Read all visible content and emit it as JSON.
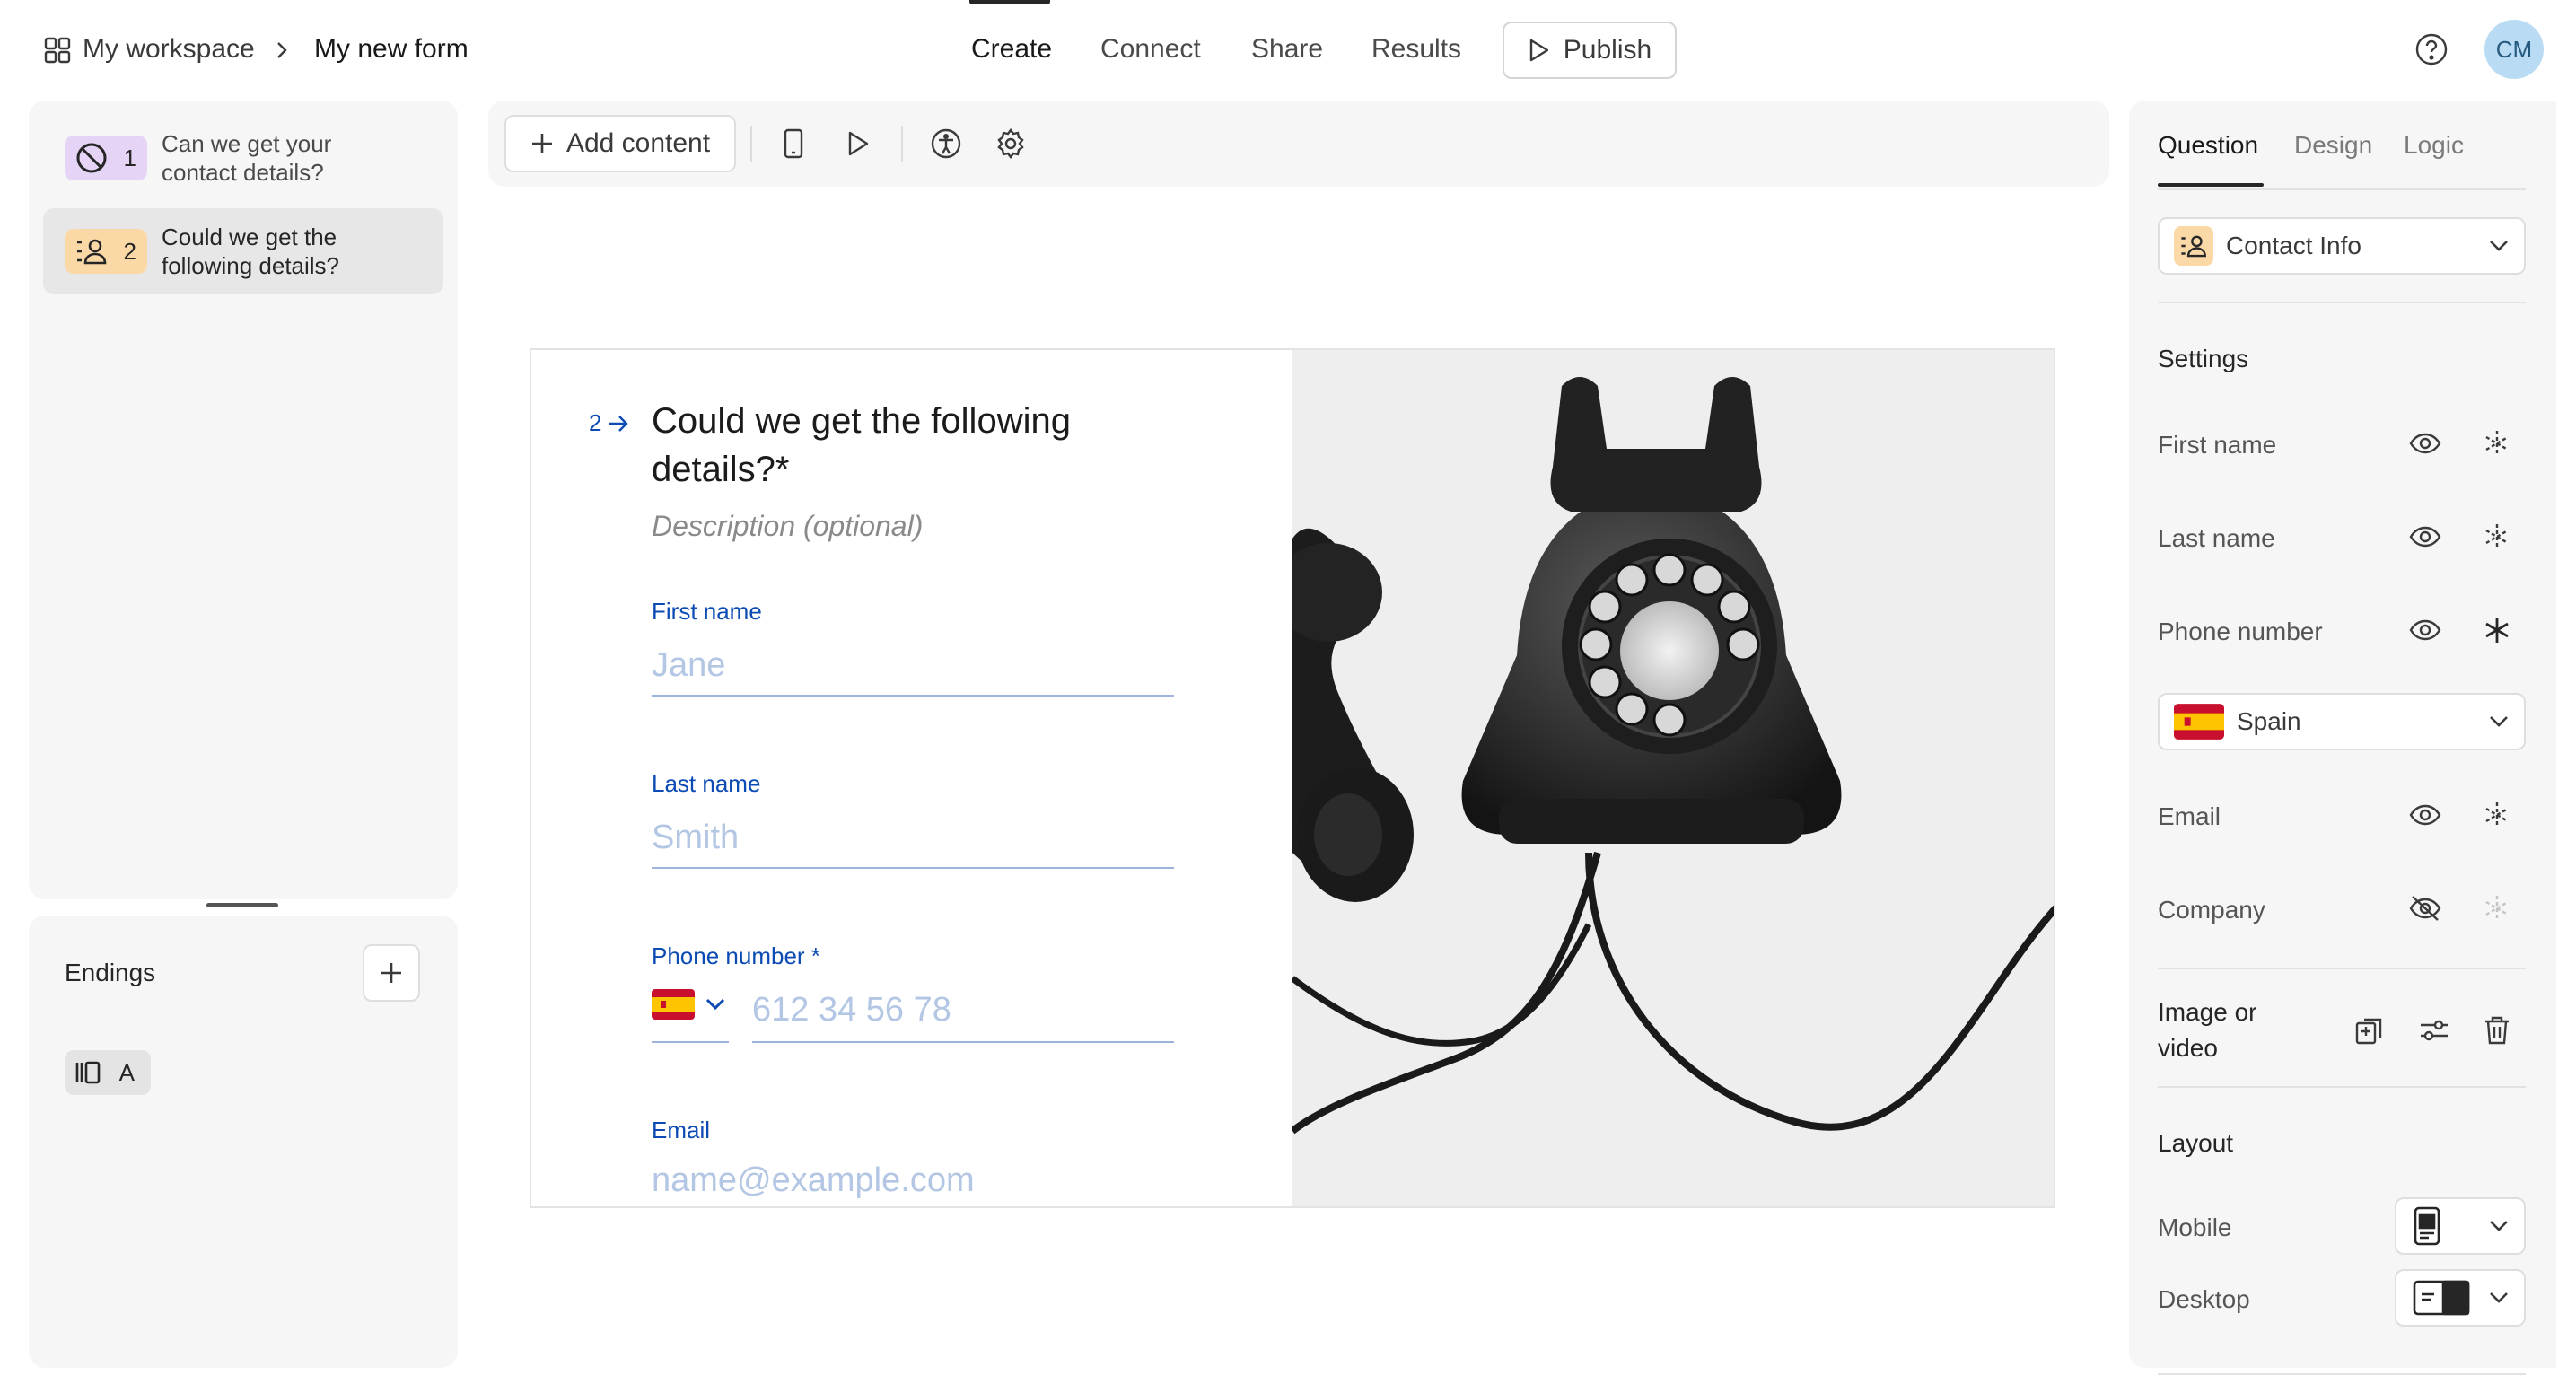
{
  "breadcrumb": {
    "workspace": "My workspace",
    "form": "My new form"
  },
  "nav": {
    "create": "Create",
    "connect": "Connect",
    "share": "Share",
    "results": "Results",
    "publish": "Publish"
  },
  "user": {
    "initials": "CM"
  },
  "questions": [
    {
      "number": "1",
      "text": "Can we get your contact details?",
      "icon": "ban-icon",
      "color": "#e6d4f6"
    },
    {
      "number": "2",
      "text": "Could we get the following details?",
      "icon": "contact-info-icon",
      "color": "#fbd9a6"
    }
  ],
  "endings": {
    "title": "Endings",
    "items": [
      {
        "label": "A",
        "icon": "ending-icon"
      }
    ]
  },
  "toolbar": {
    "add_content": "Add content"
  },
  "form": {
    "number": "2",
    "title_line1": "Could we get the following",
    "title_line2": "details?*",
    "description": "Description (optional)",
    "fields": [
      {
        "label": "First name",
        "placeholder": "Jane"
      },
      {
        "label": "Last name",
        "placeholder": "Smith"
      },
      {
        "label": "Phone number *",
        "placeholder": "612 34 56 78"
      },
      {
        "label": "Email",
        "placeholder": "name@example.com"
      }
    ]
  },
  "right_panel": {
    "tabs": [
      "Question",
      "Design",
      "Logic"
    ],
    "question_type": "Contact Info",
    "settings_title": "Settings",
    "rows": [
      {
        "label": "First name",
        "visible": true,
        "required": false
      },
      {
        "label": "Last name",
        "visible": true,
        "required": false
      },
      {
        "label": "Phone number",
        "visible": true,
        "required": true
      },
      {
        "label": "Email",
        "visible": true,
        "required": false
      },
      {
        "label": "Company",
        "visible": false,
        "required": false
      }
    ],
    "country": "Spain",
    "image_label_line1": "Image or",
    "image_label_line2": "video",
    "layout_title": "Layout",
    "mobile": "Mobile",
    "desktop": "Desktop"
  },
  "colors": {
    "accent_blue": "#0b4bb3",
    "placeholder_blue": "#b3c6e4",
    "avatar_bg": "#b9dcf4"
  }
}
